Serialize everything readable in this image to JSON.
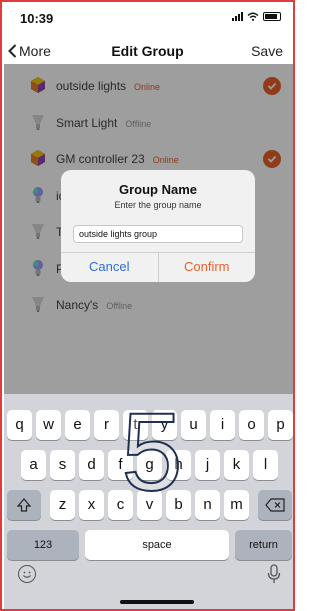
{
  "status_bar": {
    "time": "10:39"
  },
  "nav": {
    "back_label": "More",
    "title": "Edit Group",
    "save_label": "Save"
  },
  "devices": [
    {
      "name": "outside lights",
      "status": "Online",
      "icon": "hexagon-controller-icon",
      "checked": true
    },
    {
      "name": "Smart Light",
      "status": "Offline",
      "icon": "bulb-icon",
      "checked": false
    },
    {
      "name": "GM controller 23",
      "status": "Online",
      "icon": "hexagon-controller-icon",
      "checked": true
    },
    {
      "name": "ic",
      "status": "",
      "icon": "color-bulb-icon",
      "checked": false
    },
    {
      "name": "T",
      "status": "",
      "icon": "bulb-icon",
      "checked": false
    },
    {
      "name": "P",
      "status": "",
      "icon": "color-bulb-icon",
      "checked": false
    },
    {
      "name": "Nancy's",
      "status": "Offline",
      "icon": "bulb-icon",
      "checked": false
    }
  ],
  "dialog": {
    "title": "Group Name",
    "subtitle": "Enter the group name",
    "input_value": "outside lights group",
    "cancel_label": "Cancel",
    "confirm_label": "Confirm"
  },
  "keyboard": {
    "row1": [
      "q",
      "w",
      "e",
      "r",
      "t",
      "y",
      "u",
      "i",
      "o",
      "p"
    ],
    "row2": [
      "a",
      "s",
      "d",
      "f",
      "g",
      "h",
      "j",
      "k",
      "l"
    ],
    "row3": [
      "z",
      "x",
      "c",
      "v",
      "b",
      "n",
      "m"
    ],
    "numbers_label": "123",
    "space_label": "space",
    "return_label": "return"
  },
  "overlay_number": "5",
  "colors": {
    "frame": "#e23b3b",
    "online": "#e8612c",
    "offline": "#9a9a9a",
    "cancel": "#2f6fd6",
    "confirm": "#e8612c",
    "check": "#e8612c"
  }
}
